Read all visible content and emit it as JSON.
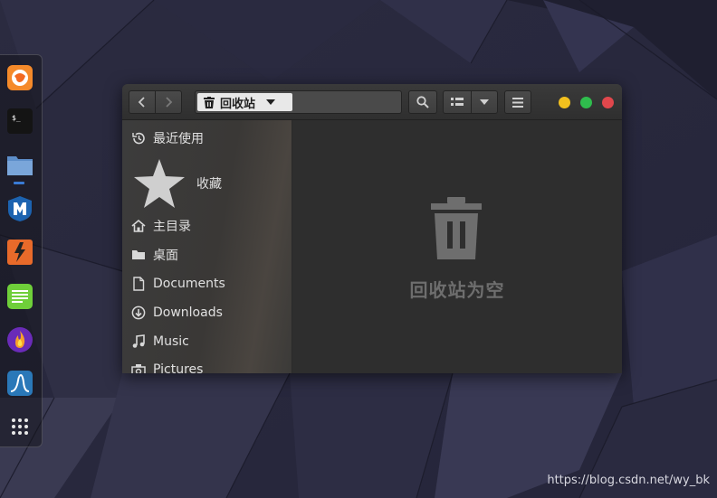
{
  "window": {
    "location": "回收站",
    "empty_message": "回收站为空"
  },
  "headerbar": {
    "back_icon": "chevron-left-icon",
    "forward_icon": "chevron-right-icon",
    "search_icon": "search-icon",
    "view_icon": "list-view-icon",
    "view_dropdown_icon": "chevron-down-icon",
    "menu_icon": "hamburger-menu-icon"
  },
  "sidebar": {
    "items": [
      {
        "label": "最近使用",
        "icon": "clock-icon"
      },
      {
        "label": "收藏",
        "icon": "star-icon"
      },
      {
        "label": "主目录",
        "icon": "home-icon"
      },
      {
        "label": "桌面",
        "icon": "folder-icon"
      },
      {
        "label": "Documents",
        "icon": "document-icon"
      },
      {
        "label": "Downloads",
        "icon": "download-icon"
      },
      {
        "label": "Music",
        "icon": "music-icon"
      },
      {
        "label": "Pictures",
        "icon": "camera-icon"
      }
    ]
  },
  "dock": {
    "apps": [
      "firefox-icon",
      "terminal-icon",
      "files-icon",
      "metasploit-icon",
      "burpsuite-icon",
      "text-editor-icon",
      "fire-icon",
      "wireshark-icon",
      "app-grid-icon"
    ]
  },
  "colors": {
    "close": "#e0474c",
    "maximize": "#2fbd4d",
    "minimize": "#f2c01e",
    "dock_accent": "#3a7bd5"
  },
  "watermark": "https://blog.csdn.net/wy_bk"
}
